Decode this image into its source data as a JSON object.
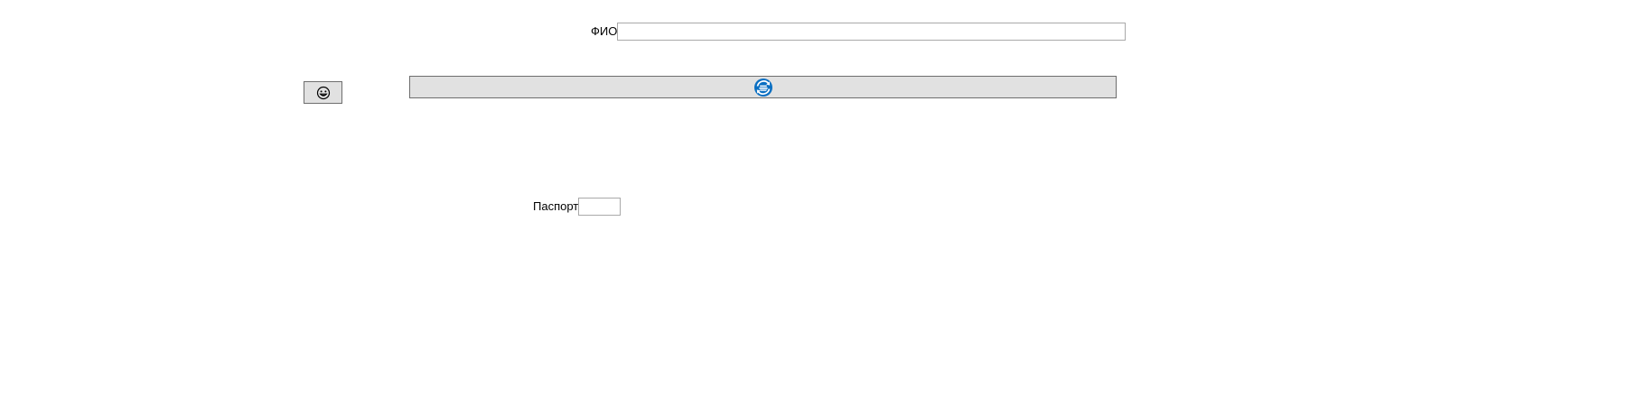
{
  "form": {
    "fio_label": "ФИО",
    "fio_value": "",
    "passport_label": "Паспорт",
    "passport_value": ""
  },
  "buttons": {
    "small_icon": "smiley-face-icon",
    "wide_icon": "refresh-ship-icon"
  },
  "colors": {
    "button_bg": "#e1e1e1",
    "button_border": "#6e6e6e",
    "input_border": "#a9a9a9",
    "accent_icon": "#0a6fc2"
  }
}
